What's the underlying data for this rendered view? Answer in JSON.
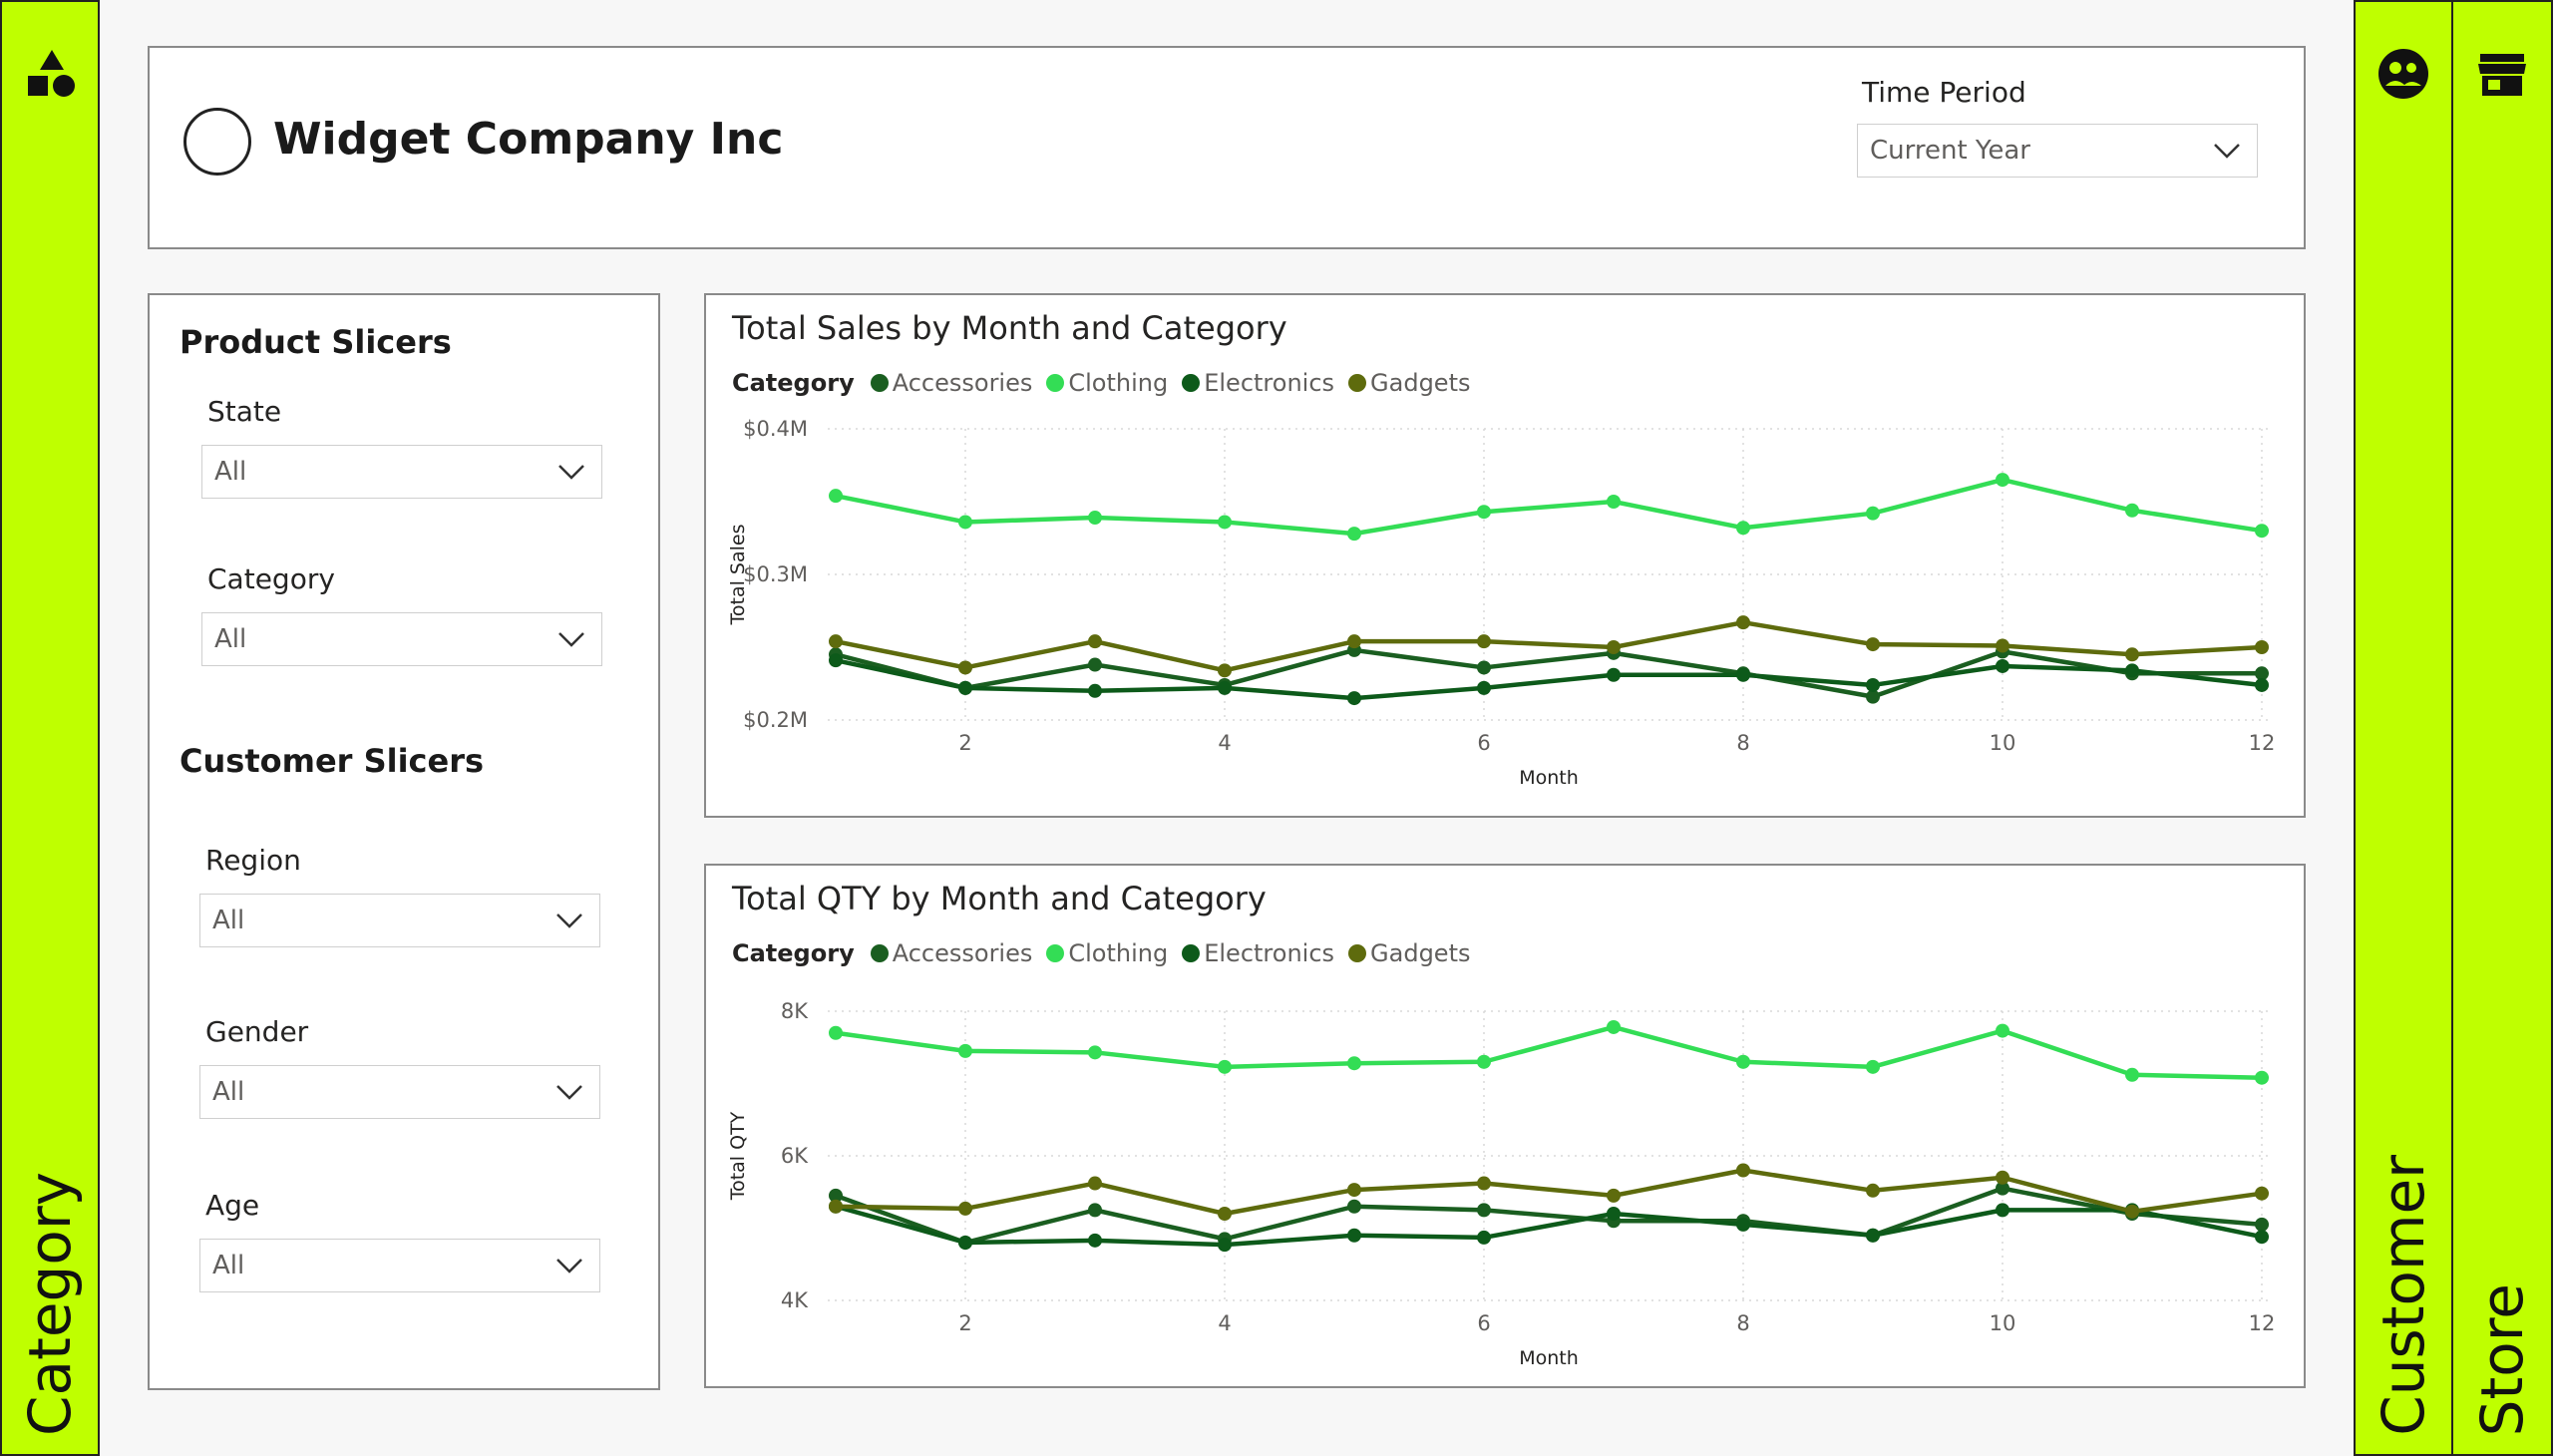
{
  "header": {
    "company_name": "Widget Company Inc",
    "time_period_label": "Time Period",
    "time_period_value": "Current Year"
  },
  "nav": {
    "left": {
      "label": "Category",
      "icon": "shapes-icon"
    },
    "right_1": {
      "label": "Customer",
      "icon": "customer-icon"
    },
    "right_2": {
      "label": "Store",
      "icon": "store-icon"
    },
    "accent_color": "#bfff00"
  },
  "slicers": {
    "product_title": "Product Slicers",
    "customer_title": "Customer Slicers",
    "state": {
      "label": "State",
      "value": "All"
    },
    "category": {
      "label": "Category",
      "value": "All"
    },
    "region": {
      "label": "Region",
      "value": "All"
    },
    "gender": {
      "label": "Gender",
      "value": "All"
    },
    "age": {
      "label": "Age",
      "value": "All"
    }
  },
  "legend": {
    "title": "Category",
    "items": [
      {
        "name": "Accessories",
        "color": "#1a5e20"
      },
      {
        "name": "Clothing",
        "color": "#33dd55"
      },
      {
        "name": "Electronics",
        "color": "#0d5a1a"
      },
      {
        "name": "Gadgets",
        "color": "#5e6b0d"
      }
    ]
  },
  "chart_data": [
    {
      "type": "line",
      "title": "Total Sales by Month and Category",
      "xlabel": "Month",
      "ylabel": "Total Sales",
      "x": [
        1,
        2,
        3,
        4,
        5,
        6,
        7,
        8,
        9,
        10,
        11,
        12
      ],
      "xticks": [
        2,
        4,
        6,
        8,
        10,
        12
      ],
      "ylim": [
        0.2,
        0.4
      ],
      "yticks": [
        0.2,
        0.3,
        0.4
      ],
      "ytick_labels": [
        "$0.2M",
        "$0.3M",
        "$0.4M"
      ],
      "series": [
        {
          "name": "Accessories",
          "color": "#1a5e20",
          "values": [
            0.245,
            0.222,
            0.238,
            0.224,
            0.248,
            0.236,
            0.246,
            0.232,
            0.216,
            0.247,
            0.232,
            0.232
          ]
        },
        {
          "name": "Clothing",
          "color": "#33dd55",
          "values": [
            0.354,
            0.336,
            0.339,
            0.336,
            0.328,
            0.343,
            0.35,
            0.332,
            0.342,
            0.365,
            0.344,
            0.33
          ]
        },
        {
          "name": "Electronics",
          "color": "#0d5a1a",
          "values": [
            0.241,
            0.222,
            0.22,
            0.222,
            0.215,
            0.222,
            0.231,
            0.231,
            0.224,
            0.237,
            0.234,
            0.224
          ]
        },
        {
          "name": "Gadgets",
          "color": "#5e6b0d",
          "values": [
            0.254,
            0.236,
            0.254,
            0.234,
            0.254,
            0.254,
            0.25,
            0.267,
            0.252,
            0.251,
            0.245,
            0.25
          ]
        }
      ]
    },
    {
      "type": "line",
      "title": "Total QTY by Month and Category",
      "xlabel": "Month",
      "ylabel": "Total QTY",
      "x": [
        1,
        2,
        3,
        4,
        5,
        6,
        7,
        8,
        9,
        10,
        11,
        12
      ],
      "xticks": [
        2,
        4,
        6,
        8,
        10,
        12
      ],
      "ylim": [
        4000,
        8000
      ],
      "yticks": [
        4000,
        6000,
        8000
      ],
      "ytick_labels": [
        "4K",
        "6K",
        "8K"
      ],
      "series": [
        {
          "name": "Accessories",
          "color": "#1a5e20",
          "values": [
            5450,
            4800,
            5250,
            4850,
            5300,
            5250,
            5100,
            5100,
            4900,
            5550,
            5200,
            5050
          ]
        },
        {
          "name": "Clothing",
          "color": "#33dd55",
          "values": [
            7700,
            7450,
            7430,
            7230,
            7280,
            7300,
            7780,
            7300,
            7230,
            7730,
            7120,
            7080
          ]
        },
        {
          "name": "Electronics",
          "color": "#0d5a1a",
          "values": [
            5300,
            4800,
            4830,
            4770,
            4900,
            4870,
            5200,
            5050,
            4900,
            5250,
            5250,
            4880
          ]
        },
        {
          "name": "Gadgets",
          "color": "#5e6b0d",
          "values": [
            5300,
            5270,
            5620,
            5200,
            5530,
            5620,
            5450,
            5800,
            5520,
            5700,
            5230,
            5480
          ]
        }
      ]
    }
  ]
}
